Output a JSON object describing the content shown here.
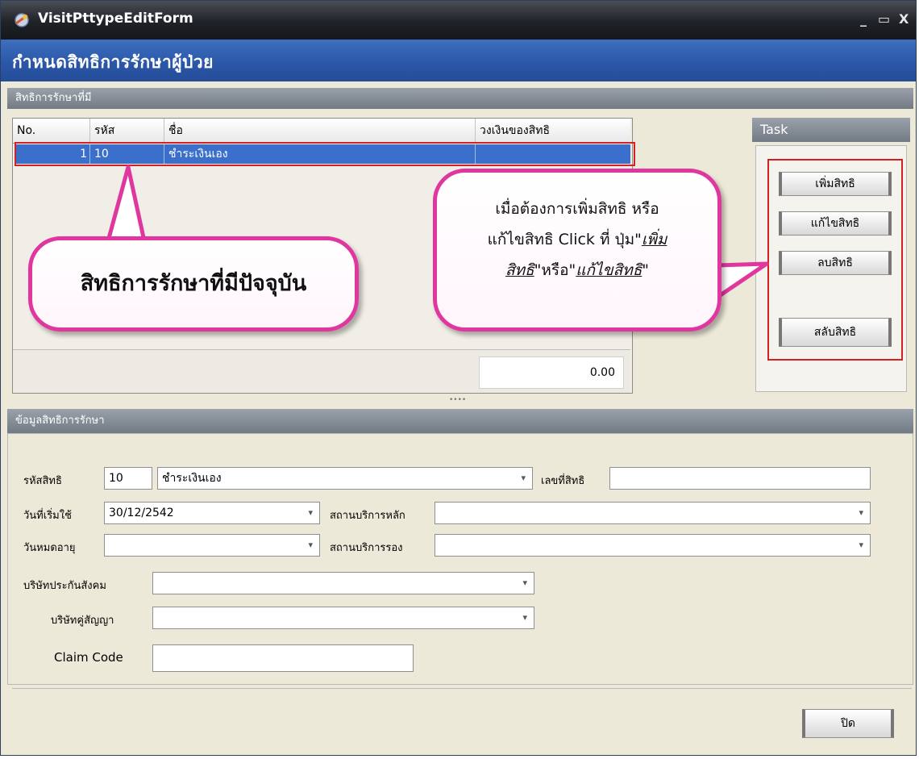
{
  "window": {
    "title": "VisitPttypeEditForm",
    "controls": {
      "minimize": "_",
      "maximize": "▭",
      "close": "X"
    }
  },
  "header": {
    "title": "กำหนดสิทธิการรักษาผู้ป่วย"
  },
  "rights_group": {
    "label": "สิทธิการรักษาที่มี",
    "columns": [
      "No.",
      "รหัส",
      "ชื่อ",
      "วงเงินของสิทธิ"
    ],
    "rows": [
      {
        "no": "1",
        "code": "10",
        "name": "ชำระเงินเอง",
        "limit": ""
      }
    ],
    "total": "0.00"
  },
  "task": {
    "label": "Task",
    "buttons": {
      "add": "เพิ่มสิทธิ",
      "edit": "แก้ไขสิทธิ",
      "delete": "ลบสิทธิ",
      "swap": "สลับสิทธิ"
    }
  },
  "callouts": {
    "left": "สิทธิการรักษาที่มีปัจจุบัน",
    "right": {
      "line1": "เมื่อต้องการเพิ่มสิทธิ หรือ",
      "line2": "แก้ไขสิทธิ Click ที่ ปุ่ม\"",
      "link1a": "เพิ่ม",
      "link1b": "สิทธิ",
      "mid": "\"หรือ\"",
      "link2": "แก้ไขสิทธิ",
      "end": "\""
    }
  },
  "info_group": {
    "label": "ข้อมูลสิทธิการรักษา",
    "fields": {
      "code_label": "รหัสสิทธิ",
      "code_value": "10",
      "name_value": "ชำระเงินเอง",
      "number_label": "เลขที่สิทธิ",
      "number_value": "",
      "start_label": "วันที่เริ่มใช้",
      "start_value": "30/12/2542",
      "main_hosp_label": "สถานบริการหลัก",
      "main_hosp_value": "",
      "expire_label": "วันหมดอายุ",
      "expire_value": "",
      "sub_hosp_label": "สถานบริการรอง",
      "sub_hosp_value": "",
      "social_label": "บริษัทประกันสังคม",
      "social_value": "",
      "contract_label": "บริษัทคู่สัญญา",
      "contract_value": "",
      "claim_label": "Claim Code",
      "claim_value": ""
    }
  },
  "footer": {
    "close_label": "ปิด"
  },
  "colors": {
    "header_blue": "#2b56a6",
    "selection": "#3a6fcb",
    "bubble_border": "#e0379f",
    "highlight_red": "#d42020"
  }
}
